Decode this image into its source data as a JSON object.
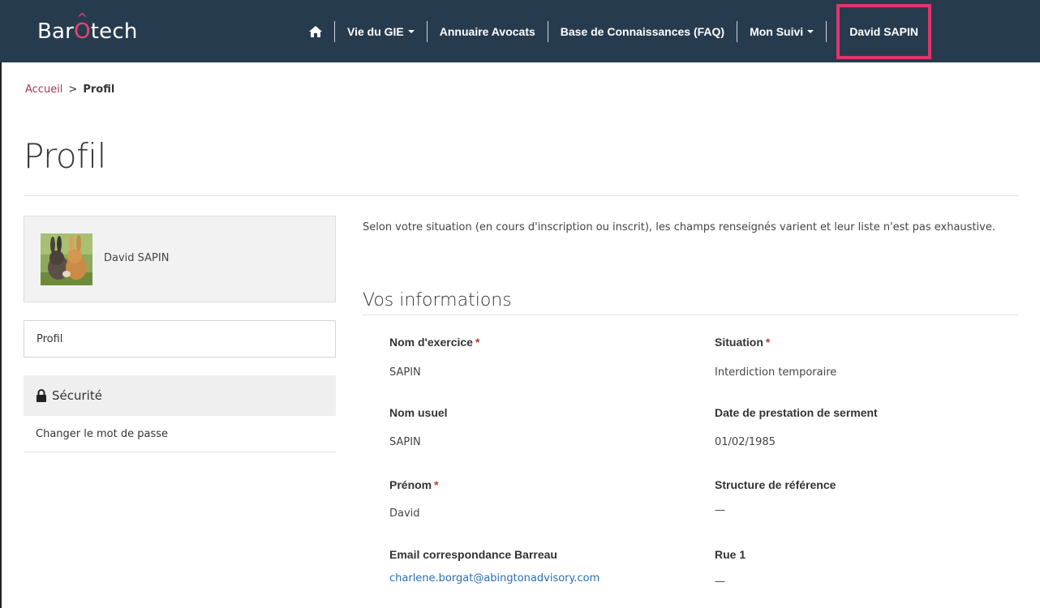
{
  "navbar": {
    "brand_prefix": "Bar",
    "brand_accent": "O",
    "brand_hat": "^",
    "brand_suffix": "tech",
    "items": [
      {
        "label": "Vie du GIE"
      },
      {
        "label": "Annuaire Avocats"
      },
      {
        "label": "Base de Connaissances (FAQ)"
      },
      {
        "label": "Mon Suivi"
      }
    ],
    "user_label": "David SAPIN",
    "icons": {
      "home": "home-icon"
    },
    "colors": {
      "background": "#273b4f",
      "accent": "#e8476e",
      "highlight_border": "#e0356b"
    }
  },
  "breadcrumb": {
    "home": "Accueil",
    "separator": ">",
    "current": "Profil"
  },
  "page": {
    "title": "Profil"
  },
  "sidebar": {
    "profile_name": "David SAPIN",
    "profil_label": "Profil",
    "security_label": "Sécurité",
    "change_password_label": "Changer le mot de passe",
    "icons": {
      "security": "lock-icon"
    }
  },
  "main": {
    "intro": "Selon votre situation (en cours d'inscription ou inscrit), les champs renseignés varient et leur liste n'est pas exhaustive.",
    "section_title": "Vos informations",
    "fields": {
      "nom_exercice": {
        "label": "Nom d'exercice",
        "required": "*",
        "value": "SAPIN"
      },
      "situation": {
        "label": "Situation",
        "required": "*",
        "value": "Interdiction temporaire"
      },
      "nom_usuel": {
        "label": "Nom usuel",
        "value": "SAPIN"
      },
      "date_serment": {
        "label": "Date de prestation de serment",
        "value": "01/02/1985"
      },
      "prenom": {
        "label": "Prénom",
        "required": "*",
        "value": "David"
      },
      "structure": {
        "label": "Structure de référence",
        "value": "—"
      },
      "email": {
        "label": "Email correspondance Barreau",
        "value": "charlene.borgat@abingtonadvisory.com"
      },
      "rue1": {
        "label": "Rue 1",
        "value": "—"
      }
    }
  }
}
